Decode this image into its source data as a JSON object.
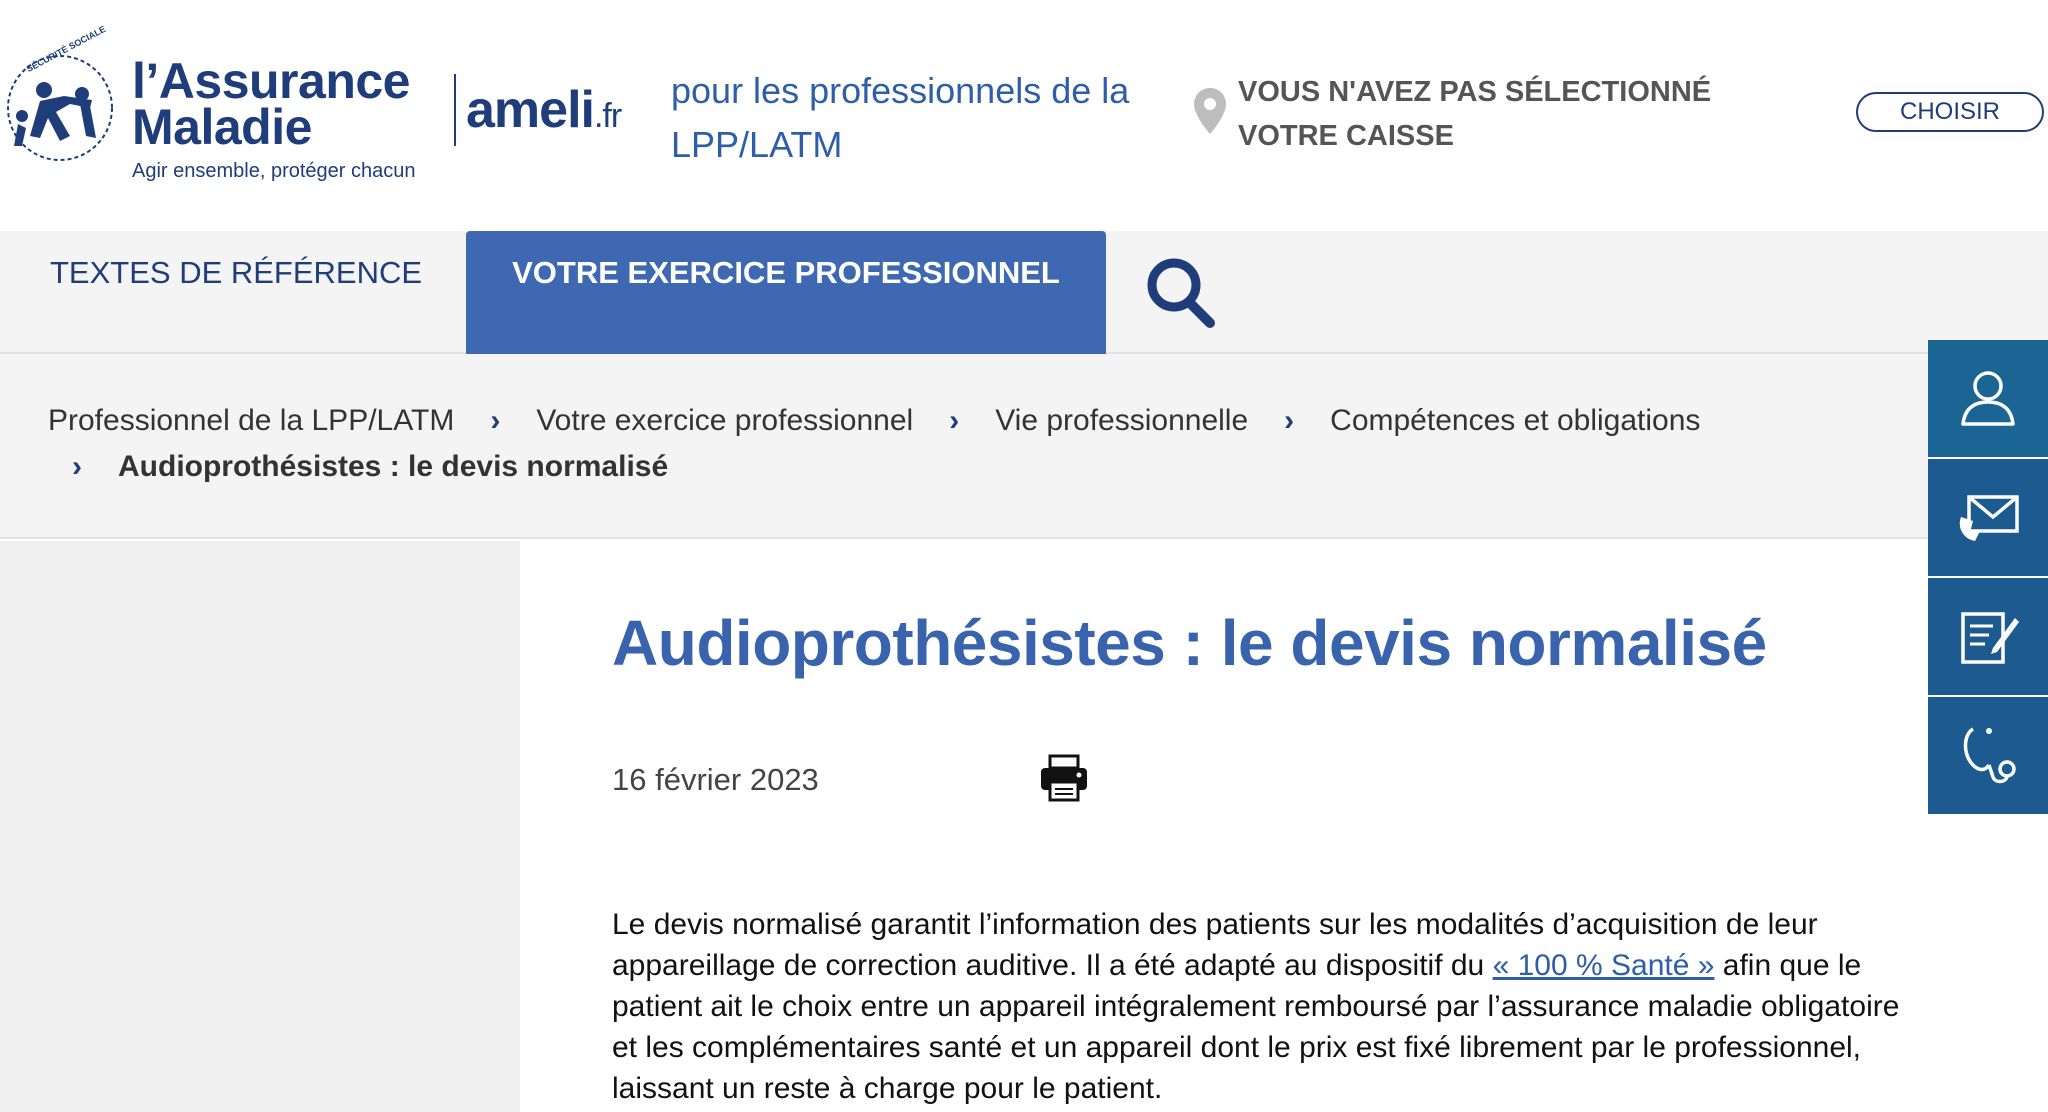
{
  "header": {
    "logo": {
      "line1": "l’Assurance",
      "line2": "Maladie",
      "tagline": "Agir ensemble, protéger chacun",
      "seal": "SÉCURITÉ SOCIALE"
    },
    "ameli": "ameli",
    "ameli_suffix": ".fr",
    "subtitle": "pour les professionnels de la LPP/LATM",
    "caisse_message": "VOUS N'AVEZ PAS SÉLECTIONNÉ VOTRE CAISSE",
    "choose_label": "CHOISIR",
    "pin_icon": "location-pin-icon"
  },
  "nav": {
    "items": [
      {
        "label": "TEXTES DE RÉFÉRENCE",
        "active": false
      },
      {
        "label": "VOTRE EXERCICE PROFESSIONNEL",
        "active": true
      }
    ],
    "search_icon": "search-icon"
  },
  "breadcrumb": {
    "items": [
      "Professionnel de la LPP/LATM",
      "Votre exercice professionnel",
      "Vie professionnelle",
      "Compétences et obligations"
    ],
    "current": "Audioprothésistes : le devis normalisé"
  },
  "article": {
    "title": "Audioprothésistes : le devis normalisé",
    "date": "16 février 2023",
    "body_before_link": "Le devis normalisé garantit l’information des patients sur les modalités d’acquisition de leur appareillage de correction auditive. Il a été adapté au dispositif du ",
    "link_text": "« 100 % Santé »",
    "body_after_link": " afin que le patient ait le choix entre un appareil intégralement remboursé par l’assurance maladie obligatoire et les complémentaires santé et un appareil dont le prix est fixé librement par le professionnel, laissant un reste à charge pour le patient."
  },
  "tools": [
    "user-icon",
    "mail-phone-icon",
    "form-edit-icon",
    "stethoscope-icon"
  ],
  "colors": {
    "brand": "#1f3d7a",
    "accent": "#3e68b1",
    "tool_bg": "#1d5a8f"
  }
}
